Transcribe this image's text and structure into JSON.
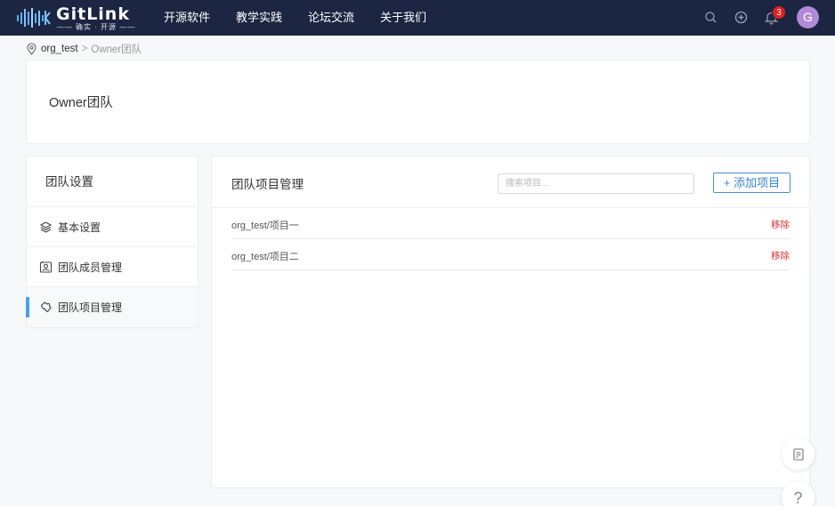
{
  "header": {
    "logo": {
      "word": "GitLink",
      "slogan": "—— 确实 · 开源 ——"
    },
    "nav": [
      "开源软件",
      "教学实践",
      "论坛交流",
      "关于我们"
    ],
    "notification_count": "3",
    "avatar_letter": "G",
    "colors": {
      "bar": "#1c2541",
      "badge": "#e02020",
      "avatar": "#b08ad9"
    }
  },
  "breadcrumb": {
    "org": "org_test",
    "separator": ">",
    "team": "Owner团队"
  },
  "team": {
    "title": "Owner团队"
  },
  "sidebar": {
    "heading": "团队设置",
    "items": [
      {
        "label": "基本设置",
        "icon": "layers-icon",
        "active": false
      },
      {
        "label": "团队成员管理",
        "icon": "member-card-icon",
        "active": false
      },
      {
        "label": "团队项目管理",
        "icon": "project-puzzle-icon",
        "active": true
      }
    ],
    "accent": "#4aa3e8"
  },
  "main": {
    "title": "团队项目管理",
    "search_placeholder": "搜索项目...",
    "add_label": "+ 添加项目",
    "projects": [
      {
        "name": "org_test/项目一",
        "action": "移除"
      },
      {
        "name": "org_test/项目二",
        "action": "移除"
      }
    ]
  },
  "float": {
    "help": "?"
  }
}
